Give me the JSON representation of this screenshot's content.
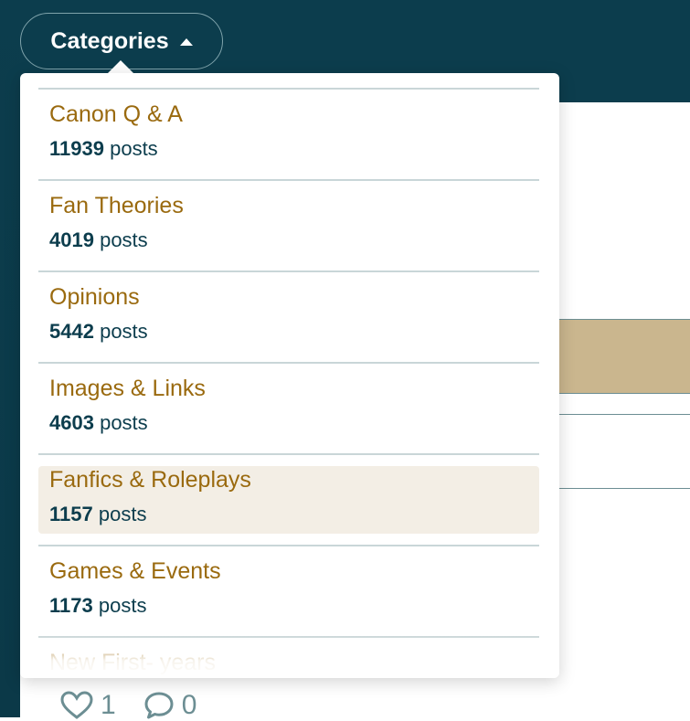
{
  "header": {
    "categories_label": "Categories"
  },
  "dropdown": {
    "items": [
      {
        "name": "Canon Q & A",
        "count": "11939",
        "count_label": "posts"
      },
      {
        "name": "Fan Theories",
        "count": "4019",
        "count_label": "posts"
      },
      {
        "name": "Opinions",
        "count": "5442",
        "count_label": "posts"
      },
      {
        "name": "Images & Links",
        "count": "4603",
        "count_label": "posts"
      },
      {
        "name": "Fanfics & Roleplays",
        "count": "1157",
        "count_label": "posts",
        "highlighted": true
      },
      {
        "name": "Games & Events",
        "count": "1173",
        "count_label": "posts"
      },
      {
        "name": "New First- years",
        "count": "",
        "count_label": ""
      }
    ]
  },
  "post_stats": {
    "likes": "1",
    "comments": "0"
  },
  "colors": {
    "header_bg": "#0c3d4d",
    "category_text": "#9a6a0f",
    "count_text": "#0c3d4d",
    "highlight_bg": "#f3eee5",
    "tan_accent": "#cab68e"
  },
  "icons": {
    "caret": "caret-up-icon",
    "like": "heart-icon",
    "comment": "comment-icon"
  }
}
